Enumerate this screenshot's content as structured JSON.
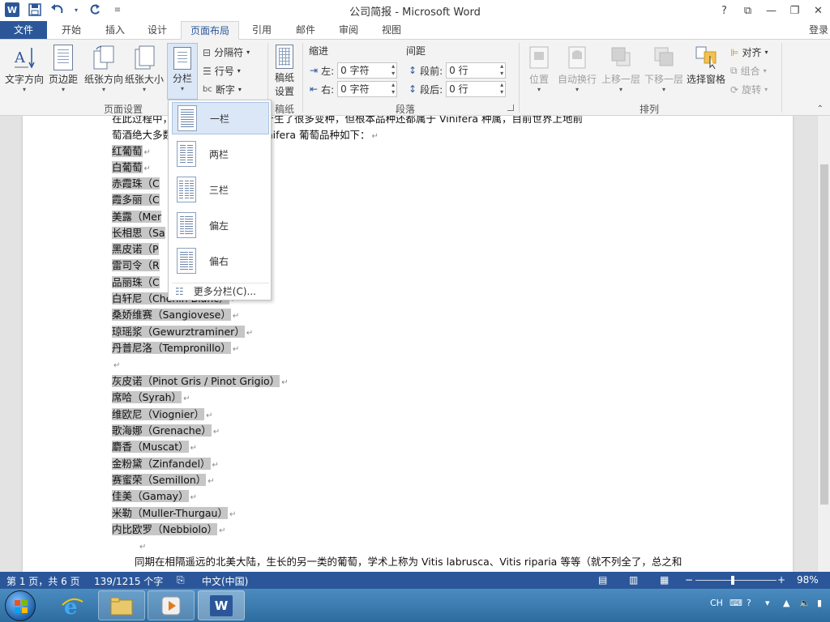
{
  "window": {
    "title": "公司简报 - Microsoft Word",
    "word_badge": "W"
  },
  "qat": {
    "save_icon": "floppy-disk-icon",
    "undo_icon": "undo-arrow-icon",
    "redo_icon": "redo-arrow-icon"
  },
  "window_buttons": {
    "help": "?",
    "ribbon_options": "⧉",
    "minimize": "—",
    "restore": "❐",
    "close": "✕"
  },
  "tabs": [
    {
      "label": "文件"
    },
    {
      "label": "开始"
    },
    {
      "label": "插入"
    },
    {
      "label": "设计"
    },
    {
      "label": "页面布局"
    },
    {
      "label": "引用"
    },
    {
      "label": "邮件"
    },
    {
      "label": "审阅"
    },
    {
      "label": "视图"
    }
  ],
  "login": "登录",
  "ribbon": {
    "page_setup": {
      "text_direction": "文字方向",
      "margins": "页边距",
      "orientation": "纸张方向",
      "size": "纸张大小",
      "columns": "分栏",
      "breaks": "分隔符",
      "line_numbers": "行号",
      "hyphenation": "断字",
      "group_label": "页面设置"
    },
    "manuscript": {
      "label1": "稿纸",
      "label2": "设置",
      "group_label": "稿纸"
    },
    "paragraph": {
      "indent_title": "缩进",
      "spacing_title": "间距",
      "left_label": "左:",
      "left_value": "0 字符",
      "right_label": "右:",
      "right_value": "0 字符",
      "before_label": "段前:",
      "before_value": "0 行",
      "after_label": "段后:",
      "after_value": "0 行",
      "group_label": "段落"
    },
    "arrange": {
      "position": "位置",
      "wrap_text": "自动换行",
      "bring_forward": "上移一层",
      "send_backward": "下移一层",
      "selection_pane": "选择窗格",
      "align": "对齐",
      "group": "组合",
      "rotate": "旋转",
      "group_label": "排列"
    }
  },
  "columns_menu": {
    "items": [
      {
        "label": "一栏"
      },
      {
        "label": "两栏"
      },
      {
        "label": "三栏"
      },
      {
        "label": "偏左"
      },
      {
        "label": "偏右"
      }
    ],
    "more": "更多分栏(C)..."
  },
  "document": {
    "line_top1": "在此过程中，……的东交替至充腥产生了很多变种，但根本品种还都属于 Vinifera 种属，目前世界上地前",
    "line_top2": "萄酒绝大多数……造地。主要的 Vinifera 葡萄品种如下：",
    "partial_items": [
      "红葡萄",
      "白葡萄",
      "赤霞珠（C",
      "霞多丽（C",
      "美露（Mer",
      "长相思（Sa",
      "黑皮诺（P",
      "雷司令（R",
      "品丽珠（C",
      "白轩尼（Chenin Blanc）"
    ],
    "items": [
      "桑娇维赛（Sangiovese）",
      "琼瑶浆（Gewurztraminer）",
      "丹普尼洛（Tempronillo）",
      "",
      "灰皮诺（Pinot Gris / Pinot Grigio）",
      "席哈（Syrah）",
      "维欧尼（Viognier）",
      "歌海娜（Grenache）",
      "麝香（Muscat）",
      "金粉黛（Zinfandel）",
      "赛蜜荣（Semillon）",
      "佳美（Gamay）",
      "米勒（Muller-Thurgau）",
      "内比欧罗（Nebbiolo）"
    ],
    "bottom_line": "同期在相隔遥远的北美大陆，生长的另一类的葡萄，学术上称为 Vitis labrusca、Vitis riparia 等等（就不列全了，总之和",
    "para_mark": "↵"
  },
  "statusbar": {
    "page": "第 1 页，共 6 页",
    "words": "139/1215 个字",
    "language": "中文(中国)",
    "zoom": "98%"
  },
  "taskbar": {
    "lang": "CH"
  }
}
